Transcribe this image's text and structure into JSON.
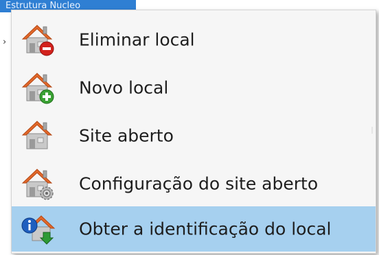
{
  "background_selection": {
    "text": "Estrutura Nucleo"
  },
  "context_menu": {
    "items": [
      {
        "label": "Eliminar local",
        "icon": "house-remove-icon",
        "highlighted": false
      },
      {
        "label": "Novo local",
        "icon": "house-add-icon",
        "highlighted": false
      },
      {
        "label": "Site aberto",
        "icon": "house-icon",
        "highlighted": false
      },
      {
        "label": "Configuração do site aberto",
        "icon": "house-settings-icon",
        "highlighted": false
      },
      {
        "label": "Obter a identificação do local",
        "icon": "house-info-icon",
        "highlighted": true
      }
    ]
  },
  "colors": {
    "menu_background": "#f6f6f6",
    "highlight": "#a6d0ef",
    "roof": "#e2682a",
    "remove_badge": "#d2221d",
    "add_badge": "#3aa133",
    "info_badge": "#1f5fbf"
  }
}
